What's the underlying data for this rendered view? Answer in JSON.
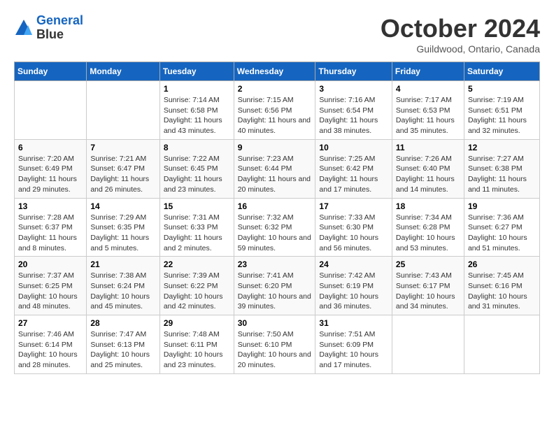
{
  "header": {
    "logo_line1": "General",
    "logo_line2": "Blue",
    "month": "October 2024",
    "location": "Guildwood, Ontario, Canada"
  },
  "weekdays": [
    "Sunday",
    "Monday",
    "Tuesday",
    "Wednesday",
    "Thursday",
    "Friday",
    "Saturday"
  ],
  "weeks": [
    [
      {
        "day": null
      },
      {
        "day": null
      },
      {
        "day": "1",
        "sunrise": "Sunrise: 7:14 AM",
        "sunset": "Sunset: 6:58 PM",
        "daylight": "Daylight: 11 hours and 43 minutes."
      },
      {
        "day": "2",
        "sunrise": "Sunrise: 7:15 AM",
        "sunset": "Sunset: 6:56 PM",
        "daylight": "Daylight: 11 hours and 40 minutes."
      },
      {
        "day": "3",
        "sunrise": "Sunrise: 7:16 AM",
        "sunset": "Sunset: 6:54 PM",
        "daylight": "Daylight: 11 hours and 38 minutes."
      },
      {
        "day": "4",
        "sunrise": "Sunrise: 7:17 AM",
        "sunset": "Sunset: 6:53 PM",
        "daylight": "Daylight: 11 hours and 35 minutes."
      },
      {
        "day": "5",
        "sunrise": "Sunrise: 7:19 AM",
        "sunset": "Sunset: 6:51 PM",
        "daylight": "Daylight: 11 hours and 32 minutes."
      }
    ],
    [
      {
        "day": "6",
        "sunrise": "Sunrise: 7:20 AM",
        "sunset": "Sunset: 6:49 PM",
        "daylight": "Daylight: 11 hours and 29 minutes."
      },
      {
        "day": "7",
        "sunrise": "Sunrise: 7:21 AM",
        "sunset": "Sunset: 6:47 PM",
        "daylight": "Daylight: 11 hours and 26 minutes."
      },
      {
        "day": "8",
        "sunrise": "Sunrise: 7:22 AM",
        "sunset": "Sunset: 6:45 PM",
        "daylight": "Daylight: 11 hours and 23 minutes."
      },
      {
        "day": "9",
        "sunrise": "Sunrise: 7:23 AM",
        "sunset": "Sunset: 6:44 PM",
        "daylight": "Daylight: 11 hours and 20 minutes."
      },
      {
        "day": "10",
        "sunrise": "Sunrise: 7:25 AM",
        "sunset": "Sunset: 6:42 PM",
        "daylight": "Daylight: 11 hours and 17 minutes."
      },
      {
        "day": "11",
        "sunrise": "Sunrise: 7:26 AM",
        "sunset": "Sunset: 6:40 PM",
        "daylight": "Daylight: 11 hours and 14 minutes."
      },
      {
        "day": "12",
        "sunrise": "Sunrise: 7:27 AM",
        "sunset": "Sunset: 6:38 PM",
        "daylight": "Daylight: 11 hours and 11 minutes."
      }
    ],
    [
      {
        "day": "13",
        "sunrise": "Sunrise: 7:28 AM",
        "sunset": "Sunset: 6:37 PM",
        "daylight": "Daylight: 11 hours and 8 minutes."
      },
      {
        "day": "14",
        "sunrise": "Sunrise: 7:29 AM",
        "sunset": "Sunset: 6:35 PM",
        "daylight": "Daylight: 11 hours and 5 minutes."
      },
      {
        "day": "15",
        "sunrise": "Sunrise: 7:31 AM",
        "sunset": "Sunset: 6:33 PM",
        "daylight": "Daylight: 11 hours and 2 minutes."
      },
      {
        "day": "16",
        "sunrise": "Sunrise: 7:32 AM",
        "sunset": "Sunset: 6:32 PM",
        "daylight": "Daylight: 10 hours and 59 minutes."
      },
      {
        "day": "17",
        "sunrise": "Sunrise: 7:33 AM",
        "sunset": "Sunset: 6:30 PM",
        "daylight": "Daylight: 10 hours and 56 minutes."
      },
      {
        "day": "18",
        "sunrise": "Sunrise: 7:34 AM",
        "sunset": "Sunset: 6:28 PM",
        "daylight": "Daylight: 10 hours and 53 minutes."
      },
      {
        "day": "19",
        "sunrise": "Sunrise: 7:36 AM",
        "sunset": "Sunset: 6:27 PM",
        "daylight": "Daylight: 10 hours and 51 minutes."
      }
    ],
    [
      {
        "day": "20",
        "sunrise": "Sunrise: 7:37 AM",
        "sunset": "Sunset: 6:25 PM",
        "daylight": "Daylight: 10 hours and 48 minutes."
      },
      {
        "day": "21",
        "sunrise": "Sunrise: 7:38 AM",
        "sunset": "Sunset: 6:24 PM",
        "daylight": "Daylight: 10 hours and 45 minutes."
      },
      {
        "day": "22",
        "sunrise": "Sunrise: 7:39 AM",
        "sunset": "Sunset: 6:22 PM",
        "daylight": "Daylight: 10 hours and 42 minutes."
      },
      {
        "day": "23",
        "sunrise": "Sunrise: 7:41 AM",
        "sunset": "Sunset: 6:20 PM",
        "daylight": "Daylight: 10 hours and 39 minutes."
      },
      {
        "day": "24",
        "sunrise": "Sunrise: 7:42 AM",
        "sunset": "Sunset: 6:19 PM",
        "daylight": "Daylight: 10 hours and 36 minutes."
      },
      {
        "day": "25",
        "sunrise": "Sunrise: 7:43 AM",
        "sunset": "Sunset: 6:17 PM",
        "daylight": "Daylight: 10 hours and 34 minutes."
      },
      {
        "day": "26",
        "sunrise": "Sunrise: 7:45 AM",
        "sunset": "Sunset: 6:16 PM",
        "daylight": "Daylight: 10 hours and 31 minutes."
      }
    ],
    [
      {
        "day": "27",
        "sunrise": "Sunrise: 7:46 AM",
        "sunset": "Sunset: 6:14 PM",
        "daylight": "Daylight: 10 hours and 28 minutes."
      },
      {
        "day": "28",
        "sunrise": "Sunrise: 7:47 AM",
        "sunset": "Sunset: 6:13 PM",
        "daylight": "Daylight: 10 hours and 25 minutes."
      },
      {
        "day": "29",
        "sunrise": "Sunrise: 7:48 AM",
        "sunset": "Sunset: 6:11 PM",
        "daylight": "Daylight: 10 hours and 23 minutes."
      },
      {
        "day": "30",
        "sunrise": "Sunrise: 7:50 AM",
        "sunset": "Sunset: 6:10 PM",
        "daylight": "Daylight: 10 hours and 20 minutes."
      },
      {
        "day": "31",
        "sunrise": "Sunrise: 7:51 AM",
        "sunset": "Sunset: 6:09 PM",
        "daylight": "Daylight: 10 hours and 17 minutes."
      },
      {
        "day": null
      },
      {
        "day": null
      }
    ]
  ]
}
